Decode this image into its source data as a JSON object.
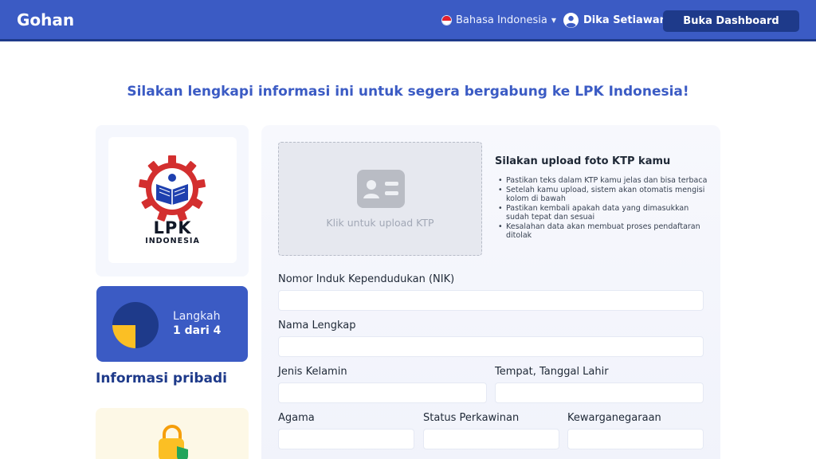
{
  "header": {
    "brand": "Gohan",
    "language": "Bahasa Indonesia",
    "user_name": "Dika Setiawan",
    "dashboard_button": "Buka Dashboard"
  },
  "headline": "Silakan lengkapi informasi ini untuk segera bergabung ke LPK Indonesia!",
  "sidebar": {
    "logo_text": "LPK",
    "logo_subtext": "INDONESIA",
    "step_label": "Langkah",
    "step_count": "1 dari 4",
    "step_progress": 0.25,
    "section_title": "Informasi pribadi"
  },
  "upload": {
    "box_text": "Klik untuk upload KTP",
    "title": "Silakan upload foto KTP kamu",
    "tips": [
      "Pastikan teks dalam KTP kamu jelas dan bisa terbaca",
      "Setelah kamu upload, sistem akan otomatis mengisi kolom di bawah",
      "Pastikan kembali apakah data yang dimasukkan sudah tepat dan sesuai",
      "Kesalahan data akan membuat proses pendaftaran ditolak"
    ]
  },
  "form": {
    "nik_label": "Nomor Induk Kependudukan (NIK)",
    "nik_value": "",
    "name_label": "Nama Lengkap",
    "name_value": "",
    "gender_label": "Jenis Kelamin",
    "gender_value": "",
    "birth_label": "Tempat, Tanggal Lahir",
    "birth_value": "",
    "religion_label": "Agama",
    "religion_value": "",
    "marital_label": "Status Perkawinan",
    "marital_value": "",
    "citizenship_label": "Kewarganegaraan",
    "citizenship_value": ""
  },
  "colors": {
    "primary": "#3b5bc4",
    "primary_dark": "#1e3a8a",
    "accent_yellow": "#fbbf24",
    "logo_red": "#d32f2f"
  },
  "icons": {
    "flag": "indonesia-flag-icon",
    "user": "user-circle-icon",
    "upload": "id-card-icon",
    "lock": "lock-shield-icon"
  }
}
